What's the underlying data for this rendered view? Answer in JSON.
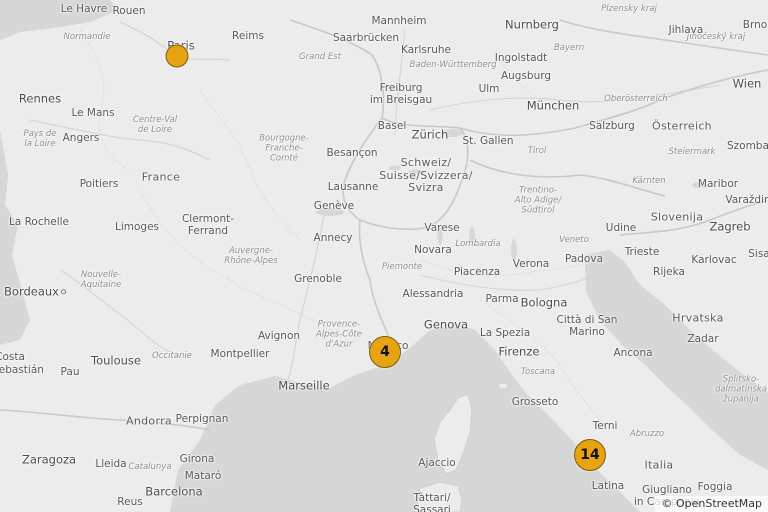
{
  "attribution": "© OpenStreetMap",
  "colors": {
    "marker_fill": "#e6a312",
    "marker_border": "#7a5a10",
    "sea": "#d7d7d7",
    "land": "#ececec"
  },
  "markers": [
    {
      "id": "paris",
      "label": "",
      "size": "small"
    },
    {
      "id": "nice",
      "label": "4",
      "size": "med"
    },
    {
      "id": "rome",
      "label": "14",
      "size": "med"
    }
  ],
  "labels": {
    "le_havre": "Le Havre",
    "rouen": "Rouen",
    "normandie": "Normandie",
    "paris": "Paris",
    "reims": "Reims",
    "mannheim": "Mannheim",
    "nurnberg": "Nurnberg",
    "plzensky_kraj": "Plzensky kraj",
    "jihocesky_kraj": "Jihočeský kraj",
    "jihlava": "Jihlava",
    "brno": "Brno",
    "saarbrucken": "Saarbrücken",
    "karlsruhe": "Karlsruhe",
    "ingolstadt": "Ingolstadt",
    "bayern": "Bayern",
    "grand_est": "Grand Est",
    "baden_wurttemberg": "Baden-Württemberg",
    "augsburg": "Augsburg",
    "rennes": "Rennes",
    "le_mans": "Le Mans",
    "angers": "Angers",
    "pays_de_la_loire": [
      "Pays de",
      "la Loire"
    ],
    "centre_val_de_loire": [
      "Centre-Val",
      "de Loire"
    ],
    "freiburg": [
      "Freiburg",
      "im Breisgau"
    ],
    "ulm": "Ulm",
    "munchen": "München",
    "oberosterreich": "Oberösterreich",
    "wien": "Wien",
    "basel": "Basel",
    "zurich": "Zürich",
    "st_gallen": "St. Gallen",
    "salzburg": "Salzburg",
    "osterreich": "Österreich",
    "szombathely": "Szombat",
    "bourgogne": [
      "Bourgogne-",
      "Franche-",
      "Comté"
    ],
    "besancon": "Besançon",
    "schweiz": [
      "Schweiz/",
      "Suisse/Svizzera/",
      "Svizra"
    ],
    "tirol": "Tirol",
    "steiermark": "Steiermark",
    "poitiers": "Poitiers",
    "france": "France",
    "lausanne": "Lausanne",
    "trentino": [
      "Trentino-",
      "Alto Adige/",
      "Südtirol"
    ],
    "karnten": "Kärnten",
    "maribor": "Maribor",
    "varazdin": "Varaždin",
    "la_rochelle": "La Rochelle",
    "geneve": "Genève",
    "slovenija": "Slovenija",
    "limoges": "Limoges",
    "clermont_ferrand": [
      "Clermont-",
      "Ferrand"
    ],
    "varese": "Varese",
    "udine": "Udine",
    "zagreb": "Zagreb",
    "annecy": "Annecy",
    "novara": "Novara",
    "lombardia": "Lombardia",
    "veneto": "Veneto",
    "trieste": "Trieste",
    "auvergne": [
      "Auvergne-",
      "Rhône-Alpes"
    ],
    "piemonte": "Piemonte",
    "verona": "Verona",
    "padova": "Padova",
    "rijeka": "Rijeka",
    "karlovac": "Karlovac",
    "sisak": "Sisa",
    "nouvelle_aquitaine": [
      "Nouvelle-",
      "Aquitaine"
    ],
    "grenoble": "Grenoble",
    "piacenza": "Piacenza",
    "bordeaux": "Bordeaux",
    "alessandria": "Alessandria",
    "parma": "Parma",
    "bologna": "Bologna",
    "avignon": "Avignon",
    "provence": [
      "Provence-",
      "Alpes-Côte",
      "d'Azur"
    ],
    "genova": "Genova",
    "citta_di_san_marino": [
      "Città di San",
      "Marino"
    ],
    "hrvatska": "Hrvatska",
    "la_spezia": "La Spezia",
    "zadar": "Zadar",
    "toulouse": "Toulouse",
    "occitanie": "Occitanie",
    "montpellier": "Montpellier",
    "monaco": "Monaco",
    "firenze": "Firenze",
    "ancona": "Ancona",
    "costa": "Costa",
    "sebastian": "Sebastián",
    "pau": "Pau",
    "marseille": "Marseille",
    "toscana": "Toscana",
    "splitsko": [
      "Splitsko-",
      "dalmatinska",
      "županija"
    ],
    "andorra": "Andorra",
    "perpignan": "Perpignan",
    "grosseto": "Grosseto",
    "terni": "Terni",
    "abruzzo": "Abruzzo",
    "zaragoza": "Zaragoza",
    "girona": "Girona",
    "ajaccio": "Ajaccio",
    "lleida": "Lleida",
    "catalunya": "Catalunya",
    "mataro": "Mataró",
    "italia": "Italia",
    "barcelona": "Barcelona",
    "reus": "Reus",
    "latina": "Latina",
    "giugliano": [
      "Giugliano",
      "in Campania"
    ],
    "foggia": "Foggia",
    "tattari": [
      "Tàttari/",
      "Sassari"
    ]
  }
}
